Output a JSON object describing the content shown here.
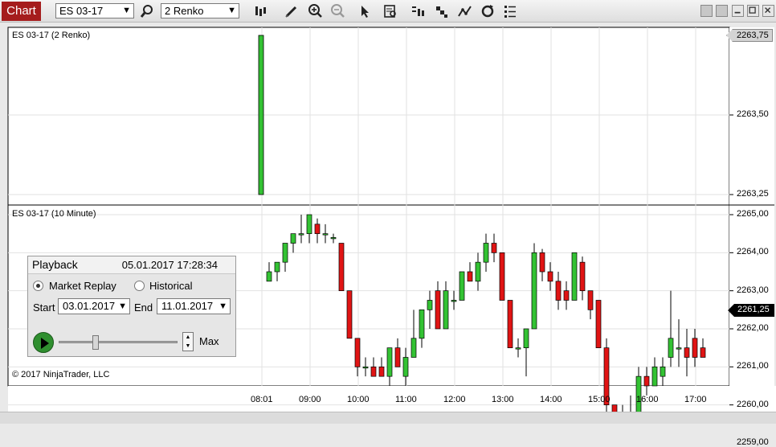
{
  "toolbar": {
    "tab_label": "Chart",
    "instrument": "ES 03-17",
    "bars_type": "2 Renko",
    "icons": [
      "bar-type-icon",
      "draw-pencil-icon",
      "zoom-in-icon",
      "zoom-out-icon",
      "pointer-icon",
      "data-box-icon",
      "chart-style-icon",
      "indicators-icon",
      "strategies-icon",
      "reload-icon",
      "properties-list-icon"
    ]
  },
  "panel1": {
    "title": "ES 03-17 (2 Renko)",
    "price_axis": [
      "2263,50",
      "2263,25"
    ],
    "current_price": "2263,75"
  },
  "panel2": {
    "title": "ES 03-17 (10 Minute)",
    "price_axis": [
      "2265,00",
      "2264,00",
      "2263,00",
      "2262,00",
      "2261,00",
      "2260,00",
      "2259,00"
    ],
    "current_price": "2261,25",
    "copyright": "© 2017 NinjaTrader, LLC"
  },
  "time_axis": [
    "08:01",
    "09:00",
    "10:00",
    "11:00",
    "12:00",
    "13:00",
    "14:00",
    "15:00",
    "16:00",
    "17:00"
  ],
  "playback": {
    "title": "Playback",
    "datetime": "05.01.2017 17:28:34",
    "mode_market_replay": "Market Replay",
    "mode_historical": "Historical",
    "start_label": "Start",
    "start_value": "03.01.2017",
    "end_label": "End",
    "end_value": "11.01.2017",
    "speed_label": "Max",
    "slider_position": 0.3
  },
  "colors": {
    "up": "#33c233",
    "down": "#e01414",
    "tab": "#a51d1d"
  },
  "chart_data": {
    "type": "candlestick",
    "renko": {
      "open": 2263.25,
      "close": 2263.75
    },
    "candles": [
      {
        "o": 2263.25,
        "h": 2263.75,
        "l": 2263.25,
        "c": 2263.5
      },
      {
        "o": 2263.5,
        "h": 2263.75,
        "l": 2263.25,
        "c": 2263.75
      },
      {
        "o": 2263.75,
        "h": 2264.25,
        "l": 2263.5,
        "c": 2264.25
      },
      {
        "o": 2264.25,
        "h": 2264.5,
        "l": 2264.0,
        "c": 2264.5
      },
      {
        "o": 2264.5,
        "h": 2265.0,
        "l": 2264.25,
        "c": 2264.5
      },
      {
        "o": 2264.5,
        "h": 2265.0,
        "l": 2264.25,
        "c": 2265.0
      },
      {
        "o": 2264.75,
        "h": 2264.9,
        "l": 2264.25,
        "c": 2264.5
      },
      {
        "o": 2264.5,
        "h": 2264.75,
        "l": 2264.25,
        "c": 2264.5
      },
      {
        "o": 2264.4,
        "h": 2264.5,
        "l": 2264.25,
        "c": 2264.4
      },
      {
        "o": 2264.25,
        "h": 2264.25,
        "l": 2263.0,
        "c": 2263.0
      },
      {
        "o": 2263.0,
        "h": 2263.0,
        "l": 2261.75,
        "c": 2261.75
      },
      {
        "o": 2261.75,
        "h": 2261.75,
        "l": 2260.75,
        "c": 2261.0
      },
      {
        "o": 2261.0,
        "h": 2261.25,
        "l": 2260.75,
        "c": 2261.0
      },
      {
        "o": 2261.0,
        "h": 2261.25,
        "l": 2260.75,
        "c": 2260.75
      },
      {
        "o": 2261.0,
        "h": 2261.25,
        "l": 2260.75,
        "c": 2260.75
      },
      {
        "o": 2260.75,
        "h": 2261.5,
        "l": 2260.5,
        "c": 2261.5
      },
      {
        "o": 2261.5,
        "h": 2261.75,
        "l": 2261.0,
        "c": 2261.0
      },
      {
        "o": 2260.75,
        "h": 2261.5,
        "l": 2260.5,
        "c": 2261.25
      },
      {
        "o": 2261.25,
        "h": 2262.5,
        "l": 2261.25,
        "c": 2261.75
      },
      {
        "o": 2261.75,
        "h": 2262.5,
        "l": 2261.5,
        "c": 2262.5
      },
      {
        "o": 2262.5,
        "h": 2263.0,
        "l": 2262.0,
        "c": 2262.75
      },
      {
        "o": 2263.0,
        "h": 2263.25,
        "l": 2262.0,
        "c": 2262.0
      },
      {
        "o": 2262.0,
        "h": 2263.25,
        "l": 2262.0,
        "c": 2263.0
      },
      {
        "o": 2262.75,
        "h": 2263.0,
        "l": 2262.5,
        "c": 2262.75
      },
      {
        "o": 2262.75,
        "h": 2263.5,
        "l": 2262.75,
        "c": 2263.5
      },
      {
        "o": 2263.5,
        "h": 2263.75,
        "l": 2263.25,
        "c": 2263.25
      },
      {
        "o": 2263.25,
        "h": 2264.0,
        "l": 2263.0,
        "c": 2263.75
      },
      {
        "o": 2263.75,
        "h": 2264.5,
        "l": 2263.5,
        "c": 2264.25
      },
      {
        "o": 2264.25,
        "h": 2264.5,
        "l": 2263.75,
        "c": 2264.0
      },
      {
        "o": 2264.0,
        "h": 2264.0,
        "l": 2262.75,
        "c": 2262.75
      },
      {
        "o": 2262.75,
        "h": 2262.75,
        "l": 2261.5,
        "c": 2261.5
      },
      {
        "o": 2261.5,
        "h": 2261.75,
        "l": 2261.25,
        "c": 2261.5
      },
      {
        "o": 2261.5,
        "h": 2262.0,
        "l": 2260.75,
        "c": 2262.0
      },
      {
        "o": 2262.0,
        "h": 2264.25,
        "l": 2262.0,
        "c": 2264.0
      },
      {
        "o": 2264.0,
        "h": 2264.1,
        "l": 2263.25,
        "c": 2263.5
      },
      {
        "o": 2263.5,
        "h": 2263.75,
        "l": 2263.0,
        "c": 2263.25
      },
      {
        "o": 2263.25,
        "h": 2263.5,
        "l": 2262.5,
        "c": 2262.75
      },
      {
        "o": 2263.0,
        "h": 2263.25,
        "l": 2262.5,
        "c": 2262.75
      },
      {
        "o": 2262.75,
        "h": 2264.0,
        "l": 2262.75,
        "c": 2264.0
      },
      {
        "o": 2263.75,
        "h": 2263.9,
        "l": 2262.75,
        "c": 2263.0
      },
      {
        "o": 2263.0,
        "h": 2263.0,
        "l": 2262.25,
        "c": 2262.5
      },
      {
        "o": 2262.75,
        "h": 2262.75,
        "l": 2261.5,
        "c": 2261.5
      },
      {
        "o": 2261.5,
        "h": 2261.75,
        "l": 2259.75,
        "c": 2260.0
      },
      {
        "o": 2260.0,
        "h": 2260.0,
        "l": 2258.75,
        "c": 2259.75
      },
      {
        "o": 2259.75,
        "h": 2260.0,
        "l": 2259.5,
        "c": 2259.75
      },
      {
        "o": 2259.5,
        "h": 2260.25,
        "l": 2259.0,
        "c": 2259.75
      },
      {
        "o": 2259.75,
        "h": 2261.0,
        "l": 2259.5,
        "c": 2260.75
      },
      {
        "o": 2260.75,
        "h": 2261.0,
        "l": 2260.25,
        "c": 2260.5
      },
      {
        "o": 2260.5,
        "h": 2261.25,
        "l": 2260.5,
        "c": 2261.0
      },
      {
        "o": 2260.75,
        "h": 2261.25,
        "l": 2260.5,
        "c": 2261.0
      },
      {
        "o": 2261.25,
        "h": 2263.0,
        "l": 2261.0,
        "c": 2261.75
      },
      {
        "o": 2261.5,
        "h": 2262.25,
        "l": 2261.0,
        "c": 2261.5
      },
      {
        "o": 2261.5,
        "h": 2262.0,
        "l": 2260.75,
        "c": 2261.25
      },
      {
        "o": 2261.75,
        "h": 2262.0,
        "l": 2261.0,
        "c": 2261.25
      },
      {
        "o": 2261.5,
        "h": 2261.75,
        "l": 2261.25,
        "c": 2261.25
      }
    ]
  }
}
